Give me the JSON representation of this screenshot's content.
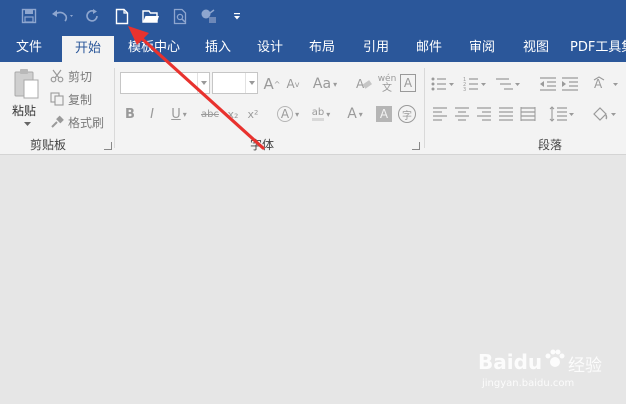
{
  "quick_access": {
    "items": [
      "save-icon",
      "undo-icon",
      "redo-icon",
      "new-document-icon",
      "open-folder-icon",
      "print-preview-icon",
      "touch-mode-icon",
      "customize-qat-icon"
    ]
  },
  "tabs": [
    {
      "label": "文件"
    },
    {
      "label": "开始"
    },
    {
      "label": "模板中心"
    },
    {
      "label": "插入"
    },
    {
      "label": "设计"
    },
    {
      "label": "布局"
    },
    {
      "label": "引用"
    },
    {
      "label": "邮件"
    },
    {
      "label": "审阅"
    },
    {
      "label": "视图"
    },
    {
      "label": "PDF工具集"
    }
  ],
  "clipboard": {
    "paste_label": "粘贴",
    "cut_label": "剪切",
    "copy_label": "复制",
    "format_painter_label": "格式刷",
    "group_label": "剪贴板"
  },
  "font": {
    "font_name_value": "",
    "font_size_value": "",
    "group_label": "字体",
    "buttons": {
      "grow": "A",
      "shrink": "A",
      "change_case": "Aa",
      "phonetic": "wén",
      "char_border": "A",
      "bold": "B",
      "italic": "I",
      "underline": "U",
      "strike": "abc",
      "subscript": "x₂",
      "superscript": "x²",
      "text_effect": "A",
      "highlight": "ab",
      "font_color": "A",
      "char_shading": "A",
      "enclose_char": "字"
    }
  },
  "paragraph": {
    "group_label": "段落"
  },
  "watermark": {
    "brand": "Baidu",
    "product": "经验",
    "url": "jingyan.baidu.com"
  },
  "colors": {
    "title_bar": "#2b579a",
    "ribbon_bg": "#f3f3f3",
    "document_bg": "#e6e6e6",
    "annotation_arrow": "#e8322e"
  }
}
